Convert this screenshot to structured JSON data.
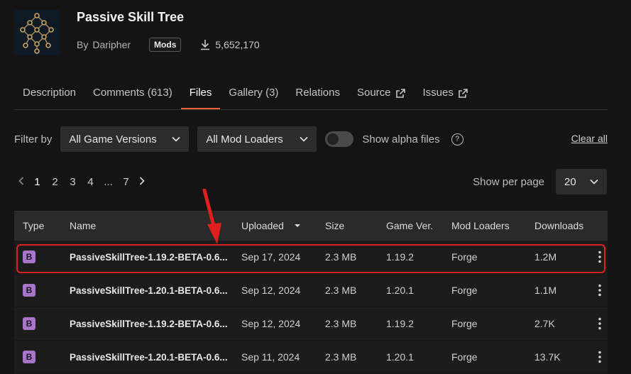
{
  "project": {
    "title": "Passive Skill Tree",
    "by_label": "By",
    "author": "Daripher",
    "category_badge": "Mods",
    "downloads": "5,652,170"
  },
  "tabs": [
    {
      "label": "Description"
    },
    {
      "label": "Comments (613)"
    },
    {
      "label": "Files"
    },
    {
      "label": "Gallery (3)"
    },
    {
      "label": "Relations"
    },
    {
      "label": "Source"
    },
    {
      "label": "Issues"
    }
  ],
  "filters": {
    "label": "Filter by",
    "game_versions": "All Game Versions",
    "mod_loaders": "All Mod Loaders",
    "alpha_label": "Show alpha files",
    "help": "?",
    "clear_all": "Clear all"
  },
  "pagination": {
    "pages": [
      "1",
      "2",
      "3",
      "4",
      "...",
      "7"
    ],
    "per_page_label": "Show per page",
    "per_page_value": "20"
  },
  "table": {
    "headers": {
      "type": "Type",
      "name": "Name",
      "uploaded": "Uploaded",
      "size": "Size",
      "game_ver": "Game Ver.",
      "mod_loaders": "Mod Loaders",
      "downloads": "Downloads"
    },
    "rows": [
      {
        "type": "B",
        "name": "PassiveSkillTree-1.19.2-BETA-0.6...",
        "uploaded": "Sep 17, 2024",
        "size": "2.3 MB",
        "game_ver": "1.19.2",
        "loader": "Forge",
        "downloads": "1.2M"
      },
      {
        "type": "B",
        "name": "PassiveSkillTree-1.20.1-BETA-0.6...",
        "uploaded": "Sep 12, 2024",
        "size": "2.3 MB",
        "game_ver": "1.20.1",
        "loader": "Forge",
        "downloads": "1.1M"
      },
      {
        "type": "B",
        "name": "PassiveSkillTree-1.19.2-BETA-0.6...",
        "uploaded": "Sep 12, 2024",
        "size": "2.3 MB",
        "game_ver": "1.19.2",
        "loader": "Forge",
        "downloads": "2.7K"
      },
      {
        "type": "B",
        "name": "PassiveSkillTree-1.20.1-BETA-0.6...",
        "uploaded": "Sep 11, 2024",
        "size": "2.3 MB",
        "game_ver": "1.20.1",
        "loader": "Forge",
        "downloads": "13.7K"
      }
    ]
  },
  "colors": {
    "accent": "#f16436",
    "highlight": "#e02020",
    "beta_badge": "#a776c8"
  }
}
